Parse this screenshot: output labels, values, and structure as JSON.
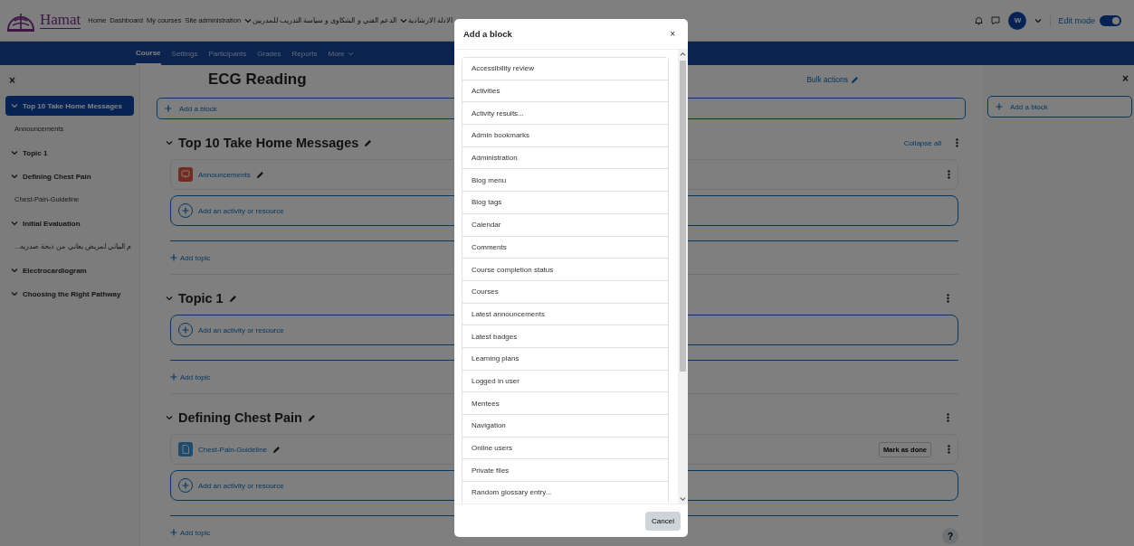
{
  "header": {
    "logo_text": "Hamat",
    "nav_links": [
      "Home",
      "Dashboard",
      "My courses",
      "Site administration"
    ],
    "dropdown_menus": [
      "الادلة الارشادية",
      "الدعم الفني و الشكاوى و سياسة التدريب للمدربين"
    ],
    "user_initial": "W",
    "edit_mode": {
      "label": "Edit mode",
      "on": true
    }
  },
  "secondary_nav": [
    {
      "label": "Course",
      "selected": true,
      "dropdown": false
    },
    {
      "label": "Settings",
      "selected": false,
      "dropdown": false
    },
    {
      "label": "Participants",
      "selected": false,
      "dropdown": false
    },
    {
      "label": "Grades",
      "selected": false,
      "dropdown": false
    },
    {
      "label": "Reports",
      "selected": false,
      "dropdown": false
    },
    {
      "label": "More",
      "selected": false,
      "dropdown": true
    }
  ],
  "course_index": {
    "close": "×",
    "items": [
      {
        "label": "Top 10 Take Home Messages",
        "selected": true,
        "expanded": true,
        "children": [
          {
            "label": "Announcements"
          }
        ]
      },
      {
        "label": "Topic 1",
        "selected": false,
        "expanded": true
      },
      {
        "label": "Defining Chest Pain",
        "selected": false,
        "expanded": true,
        "children": [
          {
            "label": "Chest-Pain-Guideline"
          }
        ]
      },
      {
        "label": "Initial Evaluation",
        "selected": false,
        "expanded": true,
        "children": [
          {
            "label": "...م البياني لمريض يعاني من ذبحة صدريه"
          }
        ]
      },
      {
        "label": "Electrocardiogram",
        "selected": false,
        "expanded": true
      },
      {
        "label": "Choosing the Right Pathway",
        "selected": false,
        "expanded": true
      }
    ]
  },
  "main": {
    "title": "ECG Reading",
    "bulk_actions": "Bulk actions",
    "add_block": "Add a block",
    "collapse_all": "Collapse all",
    "sections": [
      {
        "title": "Top 10 Take Home Messages",
        "expanded": true,
        "activities": [
          {
            "name": "Announcements",
            "kind": "forum"
          }
        ],
        "add_activity": "Add an activity or resource",
        "add_topic": "Add topic"
      },
      {
        "title": "Topic 1",
        "expanded": true,
        "add_activity": "Add an activity or resource",
        "add_topic": "Add topic"
      },
      {
        "title": "Defining Chest Pain",
        "expanded": true,
        "activities": [
          {
            "name": "Chest-Pain-Guideline",
            "kind": "pdf",
            "completion_button": "Mark as done"
          }
        ],
        "add_activity": "Add an activity or resource",
        "add_topic": "Add topic"
      }
    ]
  },
  "block_drawer": {
    "close": "×",
    "add_block": "Add a block"
  },
  "help": "?",
  "modal": {
    "title": "Add a block",
    "close": "×",
    "blocks": [
      "Accessibility review",
      "Activities",
      "Activity results...",
      "Admin bookmarks",
      "Administration",
      "Blog menu",
      "Blog tags",
      "Calendar",
      "Comments",
      "Course completion status",
      "Courses",
      "Latest announcements",
      "Latest badges",
      "Learning plans",
      "Logged in user",
      "Mentees",
      "Navigation",
      "Online users",
      "Private files",
      "Random glossary entry..."
    ],
    "cancel": "Cancel"
  }
}
